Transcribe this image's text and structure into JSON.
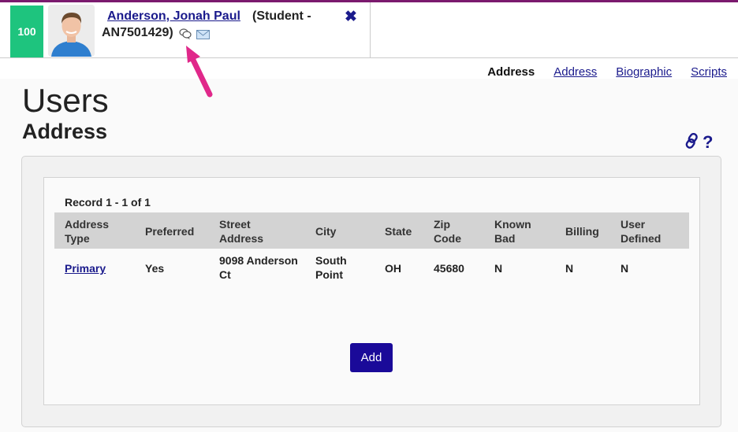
{
  "student": {
    "score": "100",
    "name": "Anderson, Jonah Paul",
    "role": "(Student -",
    "id": "AN7501429)"
  },
  "tabs": {
    "current": "Address",
    "links": [
      "Address",
      "Biographic",
      "Scripts"
    ]
  },
  "page": {
    "title": "Users",
    "subtitle": "Address"
  },
  "table": {
    "record": "Record 1  - 1  of  1",
    "headers": [
      "Address Type",
      "Preferred",
      "Street Address",
      "City",
      "State",
      "Zip Code",
      "Known Bad",
      "Billing",
      "User Defined"
    ],
    "rows": [
      [
        "Primary",
        "Yes",
        "9098 Anderson Ct",
        "South Point",
        "OH",
        "45680",
        "N",
        "N",
        "N"
      ]
    ]
  },
  "actions": {
    "add_label": "Add"
  },
  "colors": {
    "brand": "#7b1a6e",
    "score_bg": "#1ec47e",
    "link": "#1a1a8c",
    "button": "#1a0a99",
    "arrow": "#e0288a"
  },
  "icons": [
    "chat-icon",
    "email-icon",
    "close-icon",
    "link-icon",
    "help-icon",
    "pointer-arrow"
  ]
}
